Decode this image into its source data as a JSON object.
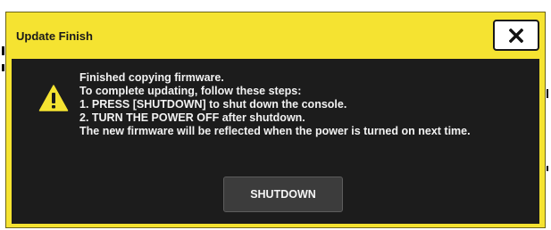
{
  "dialog": {
    "title": "Update Finish",
    "close_icon": "close-icon",
    "warning_icon": "warning-triangle-icon",
    "message_lines": [
      "Finished copying firmware.",
      "To complete updating, follow these steps:",
      "1. PRESS [SHUTDOWN] to shut down the console.",
      "2. TURN THE POWER OFF after shutdown.",
      "The new firmware will be reflected when the power is turned on next time."
    ],
    "shutdown_label": "SHUTDOWN"
  },
  "colors": {
    "frame": "#f5e331",
    "body": "#1c1c1c",
    "button": "#3c3c3c",
    "text": "#f2f2f2"
  }
}
